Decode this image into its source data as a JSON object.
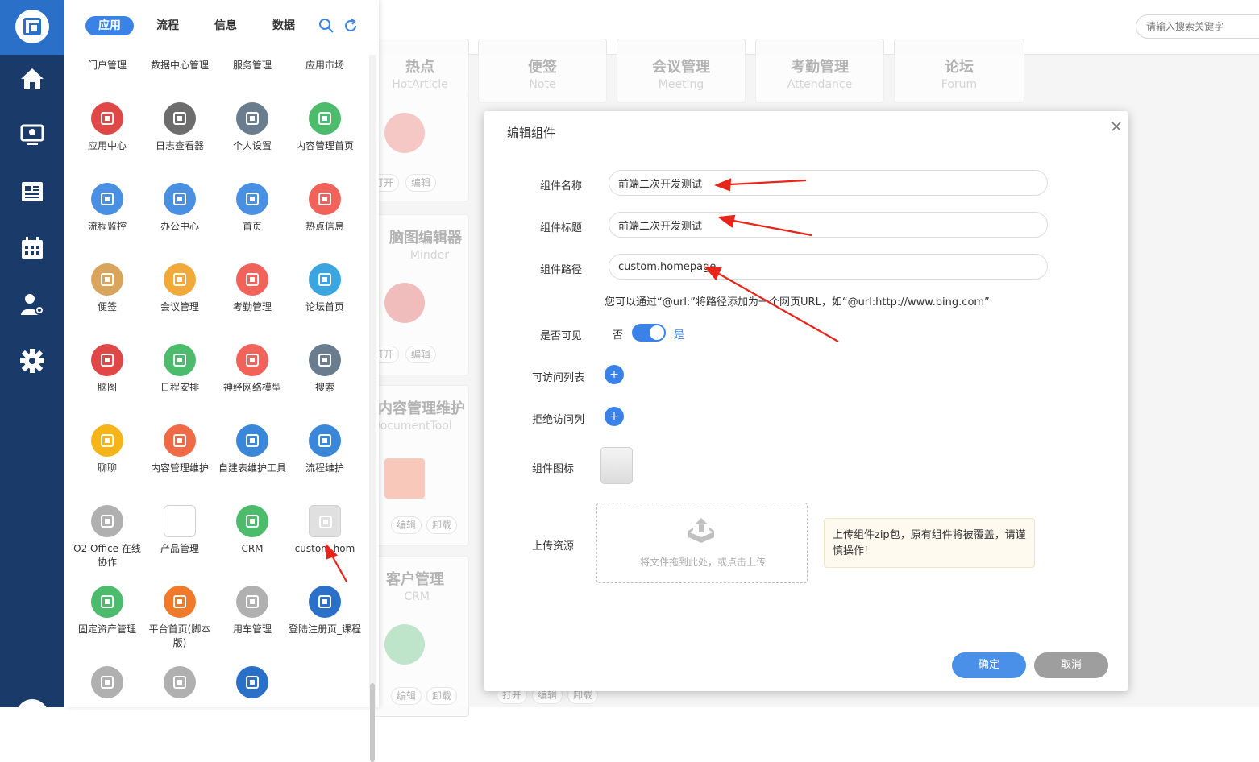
{
  "tabs": [
    {
      "label": "应用"
    },
    {
      "label": "流程"
    },
    {
      "label": "信息"
    },
    {
      "label": "数据"
    }
  ],
  "categories": [
    "门户管理",
    "数据中心管理",
    "服务管理",
    "应用市场"
  ],
  "apps": [
    {
      "label": "应用中心",
      "color": "#e04848"
    },
    {
      "label": "日志查看器",
      "color": "#6d6d6d"
    },
    {
      "label": "个人设置",
      "color": "#6a7d8e"
    },
    {
      "label": "内容管理首页",
      "color": "#4cbb6c"
    },
    {
      "label": "流程监控",
      "color": "#4a90e2"
    },
    {
      "label": "办公中心",
      "color": "#4a90e2"
    },
    {
      "label": "首页",
      "color": "#4a90e2"
    },
    {
      "label": "热点信息",
      "color": "#f0625a"
    },
    {
      "label": "便签",
      "color": "#d9a45c"
    },
    {
      "label": "会议管理",
      "color": "#f1a93a"
    },
    {
      "label": "考勤管理",
      "color": "#f0625a"
    },
    {
      "label": "论坛首页",
      "color": "#3aa5e0"
    },
    {
      "label": "脑图",
      "color": "#e04848"
    },
    {
      "label": "日程安排",
      "color": "#4cbb6c"
    },
    {
      "label": "神经网络模型",
      "color": "#f0625a"
    },
    {
      "label": "搜索",
      "color": "#6a7d8e"
    },
    {
      "label": "聊聊",
      "color": "#f5b518"
    },
    {
      "label": "内容管理维护",
      "color": "#f06a45"
    },
    {
      "label": "自建表维护工具",
      "color": "#3a86d8"
    },
    {
      "label": "流程维护",
      "color": "#3a86d8"
    },
    {
      "label": "O2 Office 在线协作",
      "color": "#b0b0b0"
    },
    {
      "label": "产品管理",
      "color": "#ffffff"
    },
    {
      "label": "CRM",
      "color": "#4cbb6c"
    },
    {
      "label": "custom.hom",
      "color": "#e0e0e0"
    },
    {
      "label": "固定资产管理",
      "color": "#4cbb6c"
    },
    {
      "label": "平台首页(脚本版)",
      "color": "#f07a2a"
    },
    {
      "label": "用车管理",
      "color": "#b0b0b0"
    },
    {
      "label": "登陆注册页_课程",
      "color": "#2a6fc8"
    },
    {
      "label": "",
      "color": "#b0b0b0"
    },
    {
      "label": "",
      "color": "#b0b0b0"
    },
    {
      "label": "",
      "color": "#2a6fc8"
    }
  ],
  "search": {
    "placeholder": "请输入搜索关键字"
  },
  "bg_cards": [
    {
      "title": "热点",
      "subtitle": "HotArticle"
    },
    {
      "title": "便签",
      "subtitle": "Note"
    },
    {
      "title": "会议管理",
      "subtitle": "Meeting"
    },
    {
      "title": "考勤管理",
      "subtitle": "Attendance"
    },
    {
      "title": "论坛",
      "subtitle": "Forum"
    },
    {
      "title": "脑图编辑器",
      "subtitle": "Minder"
    },
    {
      "title": "内容管理维护",
      "subtitle": "DocumentTool"
    },
    {
      "title": "客户管理",
      "subtitle": "CRM"
    }
  ],
  "bg_buttons": {
    "open": "打开",
    "edit": "编辑",
    "uninstall": "卸载"
  },
  "dialog": {
    "title": "编辑组件",
    "name_label": "组件名称",
    "name_value": "前端二次开发测试",
    "title_label": "组件标题",
    "title_value": "前端二次开发测试",
    "path_label": "组件路径",
    "path_value": "custom.homepage",
    "hint": "您可以通过“@url:”将路径添加为一个网页URL，如“@url:http://www.bing.com”",
    "visible_label": "是否可见",
    "visible_no": "否",
    "visible_yes": "是",
    "visible_on": true,
    "allow_label": "可访问列表",
    "deny_label": "拒绝访问列",
    "icon_label": "组件图标",
    "upload_label": "上传资源",
    "upload_text": "将文件拖到此处，或点击上传",
    "warning": "上传组件zip包，原有组件将被覆盖，请谨慎操作!",
    "ok": "确定",
    "cancel": "取消",
    "add": "+"
  },
  "colors": {
    "accent": "#3b82e6",
    "nav": "#1a3b6a",
    "annotation": "#e8251b"
  }
}
